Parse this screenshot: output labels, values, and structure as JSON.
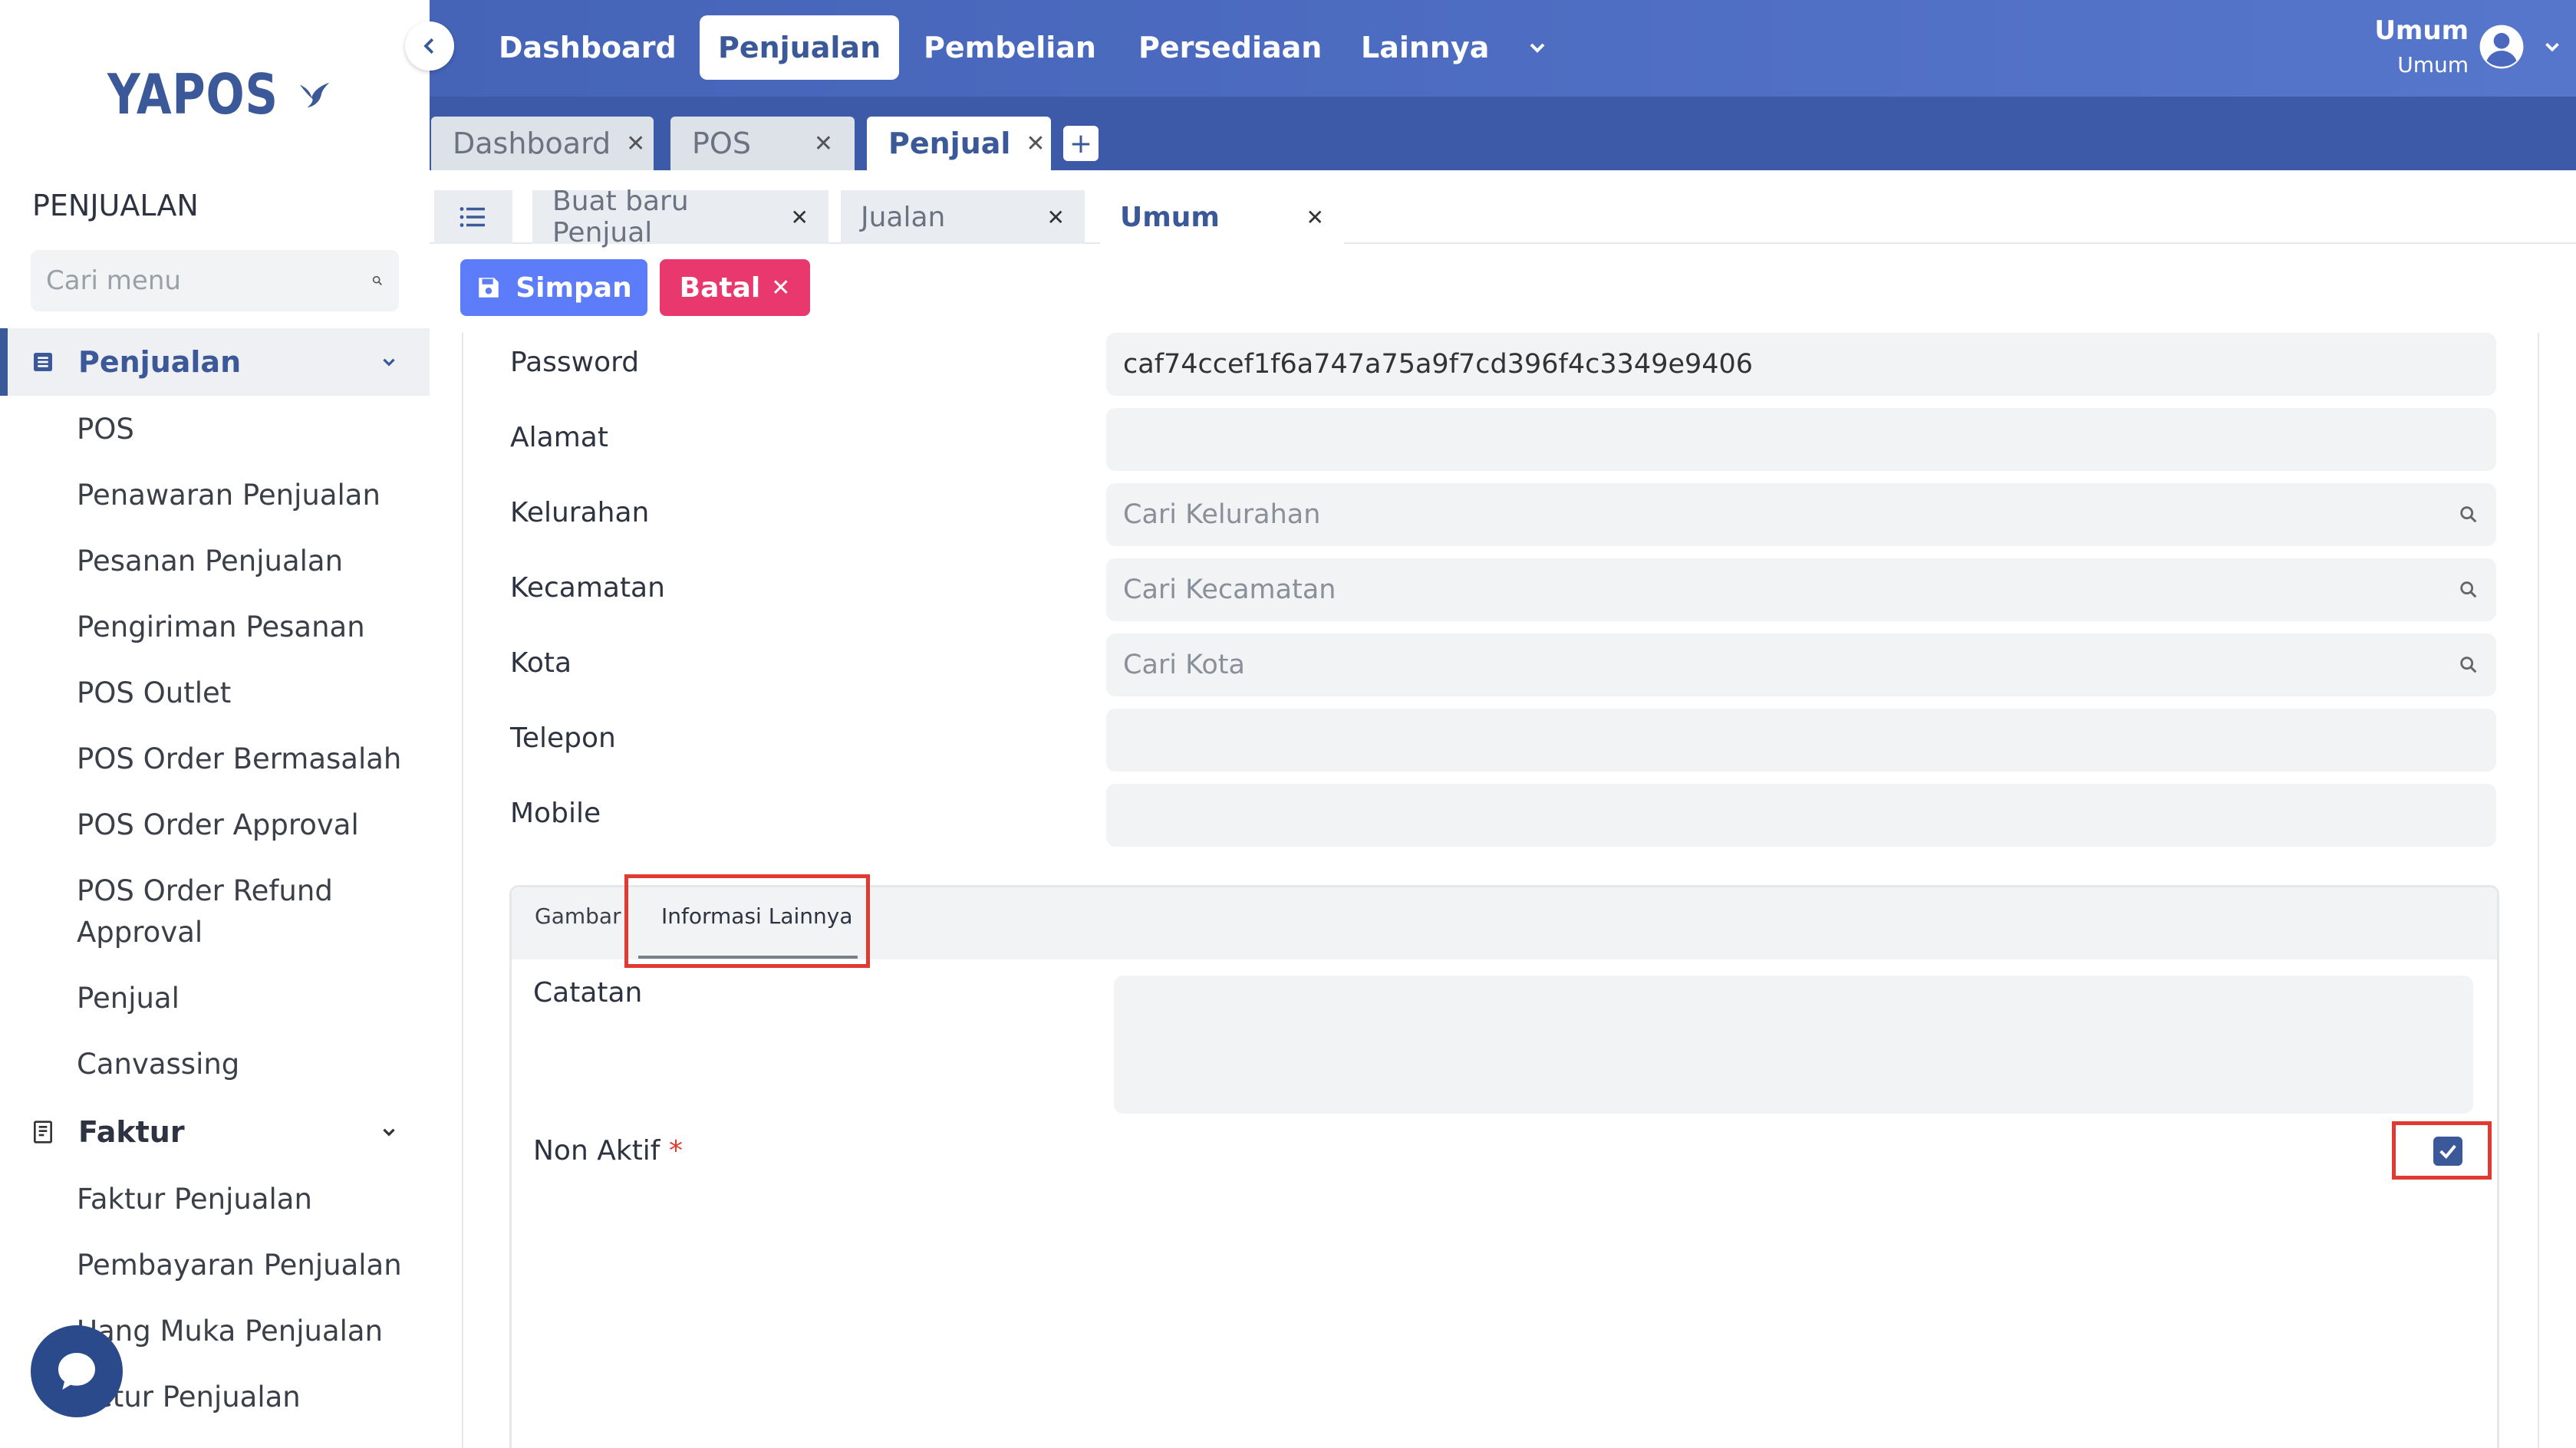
{
  "app": {
    "logo_text": "YAPOS"
  },
  "sidebar": {
    "section_title": "PENJUALAN",
    "search_placeholder": "Cari menu",
    "groups": [
      {
        "label": "Penjualan",
        "icon": "list-box-icon",
        "active": true,
        "items": [
          "POS",
          "Penawaran Penjualan",
          "Pesanan Penjualan",
          "Pengiriman Pesanan",
          "POS Outlet",
          "POS Order Bermasalah",
          "POS Order Approval",
          "POS Order Refund Approval",
          "Penjual",
          "Canvassing"
        ]
      },
      {
        "label": "Faktur",
        "icon": "receipt-icon",
        "active": false,
        "items": [
          "Faktur Penjualan",
          "Pembayaran Penjualan",
          "Uang Muka Penjualan",
          "Retur Penjualan"
        ]
      }
    ]
  },
  "topnav": {
    "items": [
      "Dashboard",
      "Penjualan",
      "Pembelian",
      "Persediaan",
      "Lainnya"
    ],
    "active": "Penjualan",
    "user_name": "Umum",
    "user_role": "Umum"
  },
  "window_tabs": [
    {
      "label": "Dashboard",
      "active": false
    },
    {
      "label": "POS",
      "active": false
    },
    {
      "label": "Penjual",
      "active": true
    }
  ],
  "window_tab_add": "+",
  "inner_tabs": [
    {
      "label": "Buat baru Penjual",
      "active": false
    },
    {
      "label": "Jualan",
      "active": false
    },
    {
      "label": "Umum",
      "active": true
    }
  ],
  "actions": {
    "save": "Simpan",
    "cancel": "Batal"
  },
  "form": {
    "fields": [
      {
        "label": "Password",
        "value": "caf74ccef1f6a747a75a9f7cd396f4c3349e9406",
        "placeholder": ""
      },
      {
        "label": "Alamat",
        "value": "",
        "placeholder": ""
      },
      {
        "label": "Kelurahan",
        "value": "",
        "placeholder": "Cari Kelurahan",
        "search": true
      },
      {
        "label": "Kecamatan",
        "value": "",
        "placeholder": "Cari Kecamatan",
        "search": true
      },
      {
        "label": "Kota",
        "value": "",
        "placeholder": "Cari Kota",
        "search": true
      },
      {
        "label": "Telepon",
        "value": "",
        "placeholder": ""
      },
      {
        "label": "Mobile",
        "value": "",
        "placeholder": ""
      }
    ]
  },
  "panel": {
    "tabs": [
      "Gambar",
      "Informasi Lainnya"
    ],
    "active_tab": "Informasi Lainnya",
    "catatan_label": "Catatan",
    "catatan_value": "",
    "non_aktif_label": "Non Aktif",
    "required_mark": "*",
    "non_aktif_checked": true
  },
  "colors": {
    "primary": "#3b5998",
    "save": "#5c7cfa",
    "cancel": "#e8386d",
    "highlight": "#e03a33"
  }
}
